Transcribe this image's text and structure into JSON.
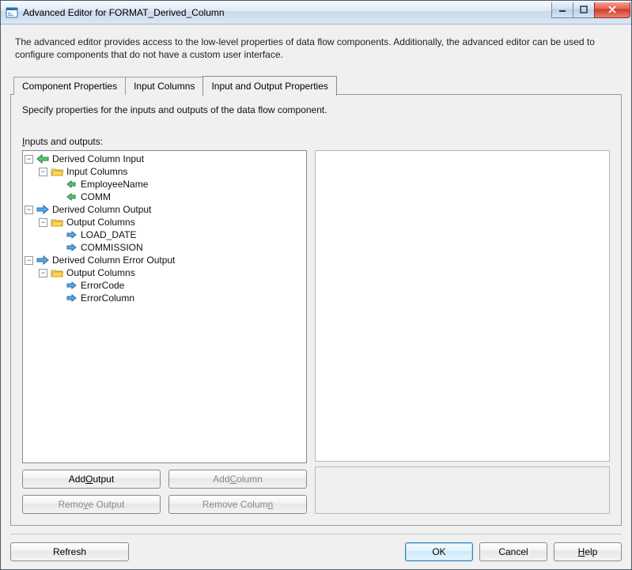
{
  "window": {
    "title": "Advanced Editor for FORMAT_Derived_Column"
  },
  "description": "The advanced editor provides access to the low-level properties of data flow components. Additionally, the advanced editor can be used to configure components that do not have a custom user interface.",
  "tabs": {
    "component_properties": "Component Properties",
    "input_columns": "Input Columns",
    "input_output_properties": "Input and Output Properties"
  },
  "tabpage": {
    "specify_text": "Specify properties for the inputs and outputs of the data flow component.",
    "io_label_prefix": "I",
    "io_label_rest": "nputs and outputs:"
  },
  "tree": {
    "n1": "Derived Column Input",
    "n1_1": "Input Columns",
    "n1_1_1": "EmployeeName",
    "n1_1_2": "COMM",
    "n2": "Derived Column Output",
    "n2_1": "Output Columns",
    "n2_1_1": "LOAD_DATE",
    "n2_1_2": "COMMISSION",
    "n3": "Derived Column Error Output",
    "n3_1": "Output Columns",
    "n3_1_1": "ErrorCode",
    "n3_1_2": "ErrorColumn"
  },
  "tree_buttons": {
    "add_output_pre": "Add ",
    "add_output_accel": "O",
    "add_output_post": "utput",
    "add_column_pre": "Add ",
    "add_column_accel": "C",
    "add_column_post": "olumn",
    "remove_output_pre": "Remo",
    "remove_output_accel": "v",
    "remove_output_post": "e Output",
    "remove_column_pre": "Remove Colum",
    "remove_column_accel": "n",
    "remove_column_post": ""
  },
  "footer": {
    "refresh": "Refresh",
    "ok": "OK",
    "cancel": "Cancel",
    "help_accel": "H",
    "help_rest": "elp"
  }
}
